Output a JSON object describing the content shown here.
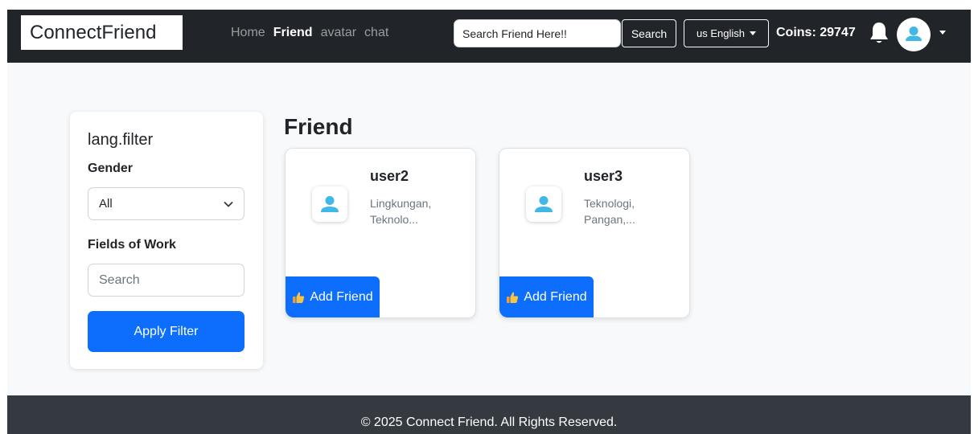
{
  "navbar": {
    "brand": "ConnectFriend",
    "links": [
      {
        "label": "Home",
        "active": false
      },
      {
        "label": "Friend",
        "active": true
      },
      {
        "label": "avatar",
        "active": false
      },
      {
        "label": "chat",
        "active": false
      }
    ],
    "search_placeholder": "Search Friend Here!!",
    "search_label": "Search",
    "language_label": "us English",
    "coins_label": "Coins: 29747"
  },
  "filter": {
    "title": "lang.filter",
    "gender_label": "Gender",
    "gender_value": "All",
    "fields_label": "Fields of Work",
    "fields_placeholder": "Search",
    "apply_label": "Apply Filter"
  },
  "friends": {
    "title": "Friend",
    "add_label": "Add Friend",
    "items": [
      {
        "name": "user2",
        "fields": "Lingkungan, Teknolo..."
      },
      {
        "name": "user3",
        "fields": "Teknologi, Pangan,..."
      }
    ]
  },
  "footer": {
    "text": "© 2025 Connect Friend. All Rights Reserved."
  },
  "colors": {
    "primary": "#0d6efd",
    "navbar": "#212529",
    "footer": "#343a40",
    "avatar_icon": "#3fb8e8"
  }
}
